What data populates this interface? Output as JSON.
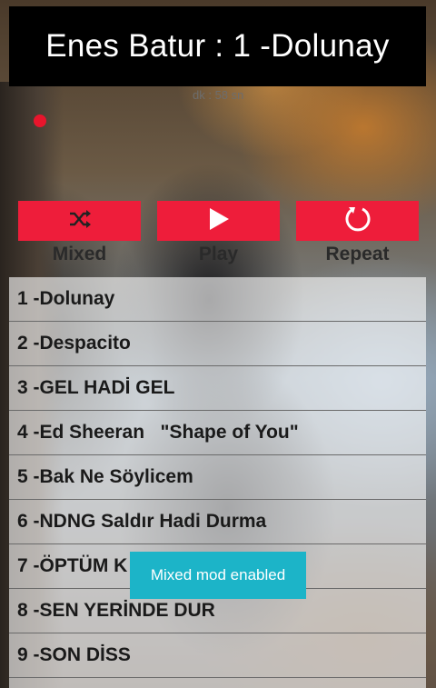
{
  "header": {
    "title": "Enes Batur : 1 -Dolunay"
  },
  "player": {
    "duration_text": "dk : 58 sn"
  },
  "controls": {
    "mixed": {
      "label": "Mixed",
      "icon": "shuffle-icon"
    },
    "play": {
      "label": "Play",
      "icon": "play-icon"
    },
    "repeat": {
      "label": "Repeat",
      "icon": "repeat-icon"
    }
  },
  "playlist": [
    "1 -Dolunay",
    "2 -Despacito",
    "3 -GEL HADİ GEL",
    "4 -Ed Sheeran   \"Shape of You\"",
    "5 -Bak Ne Söylicem",
    "6 -NDNG Saldır Hadi Durma",
    "7 -ÖPTÜM K",
    "8 -SEN YERİNDE DUR",
    "9 -SON DİSS"
  ],
  "toast": {
    "message": "Mixed mod enabled"
  },
  "colors": {
    "accent": "#ee1d3a",
    "header_bg": "#000000",
    "toast_bg": "#1cb4c8"
  }
}
